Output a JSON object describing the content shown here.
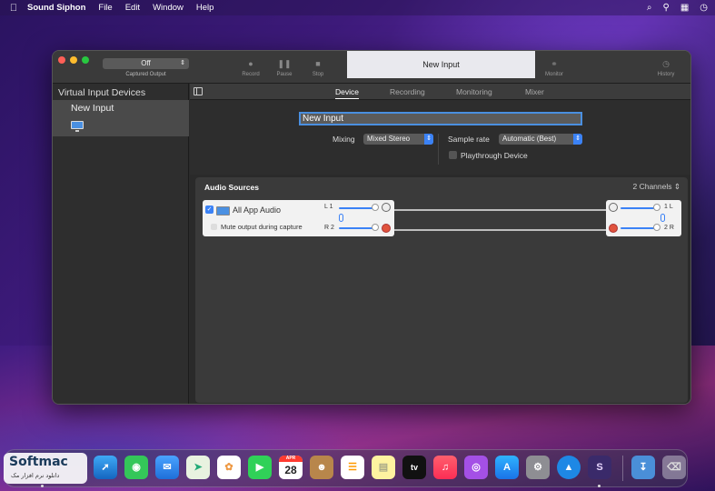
{
  "menubar": {
    "app_name": "Sound Siphon",
    "items": [
      "File",
      "Edit",
      "Window",
      "Help"
    ],
    "status_icons": [
      "wifi-icon",
      "search-icon",
      "control-center-icon",
      "clock-icon"
    ]
  },
  "toolbar": {
    "output_select_value": "Off",
    "output_caption": "Captured Output",
    "record_label": "Record",
    "pause_label": "Pause",
    "stop_label": "Stop",
    "window_title": "New Input",
    "monitor_label": "Monitor",
    "history_label": "History"
  },
  "sidebar": {
    "heading": "Virtual Input Devices",
    "selected_item": "New Input",
    "add_label": "+",
    "remove_label": "−"
  },
  "tabs": [
    "Device",
    "Recording",
    "Monitoring",
    "Mixer"
  ],
  "active_tab": "Device",
  "device": {
    "name_value": "New Input",
    "mixing_label": "Mixing",
    "mixing_value": "Mixed Stereo",
    "sample_rate_label": "Sample rate",
    "sample_rate_value": "Automatic (Best)",
    "playthrough_label": "Playthrough Device",
    "playthrough_checked": false
  },
  "audio_sources": {
    "title": "Audio Sources",
    "channels_label": "2 Channels",
    "source": {
      "name": "All App Audio",
      "checked": true,
      "mute_label": "Mute output during capture",
      "left_label": "L 1",
      "right_label": "R 2",
      "left_level": 0.85,
      "right_level": 0.85
    },
    "output": {
      "left_label": "1 L",
      "right_label": "2 R",
      "left_level": 0.85,
      "right_level": 0.85
    }
  },
  "main_footer": {
    "add_label": "+",
    "remove_label": "−"
  },
  "dock": {
    "calendar_month": "APR",
    "calendar_day": "28",
    "tv_label": "tv"
  },
  "watermark": {
    "logo": "Softmac",
    "sub": "دانلود نرم افزار مک"
  }
}
